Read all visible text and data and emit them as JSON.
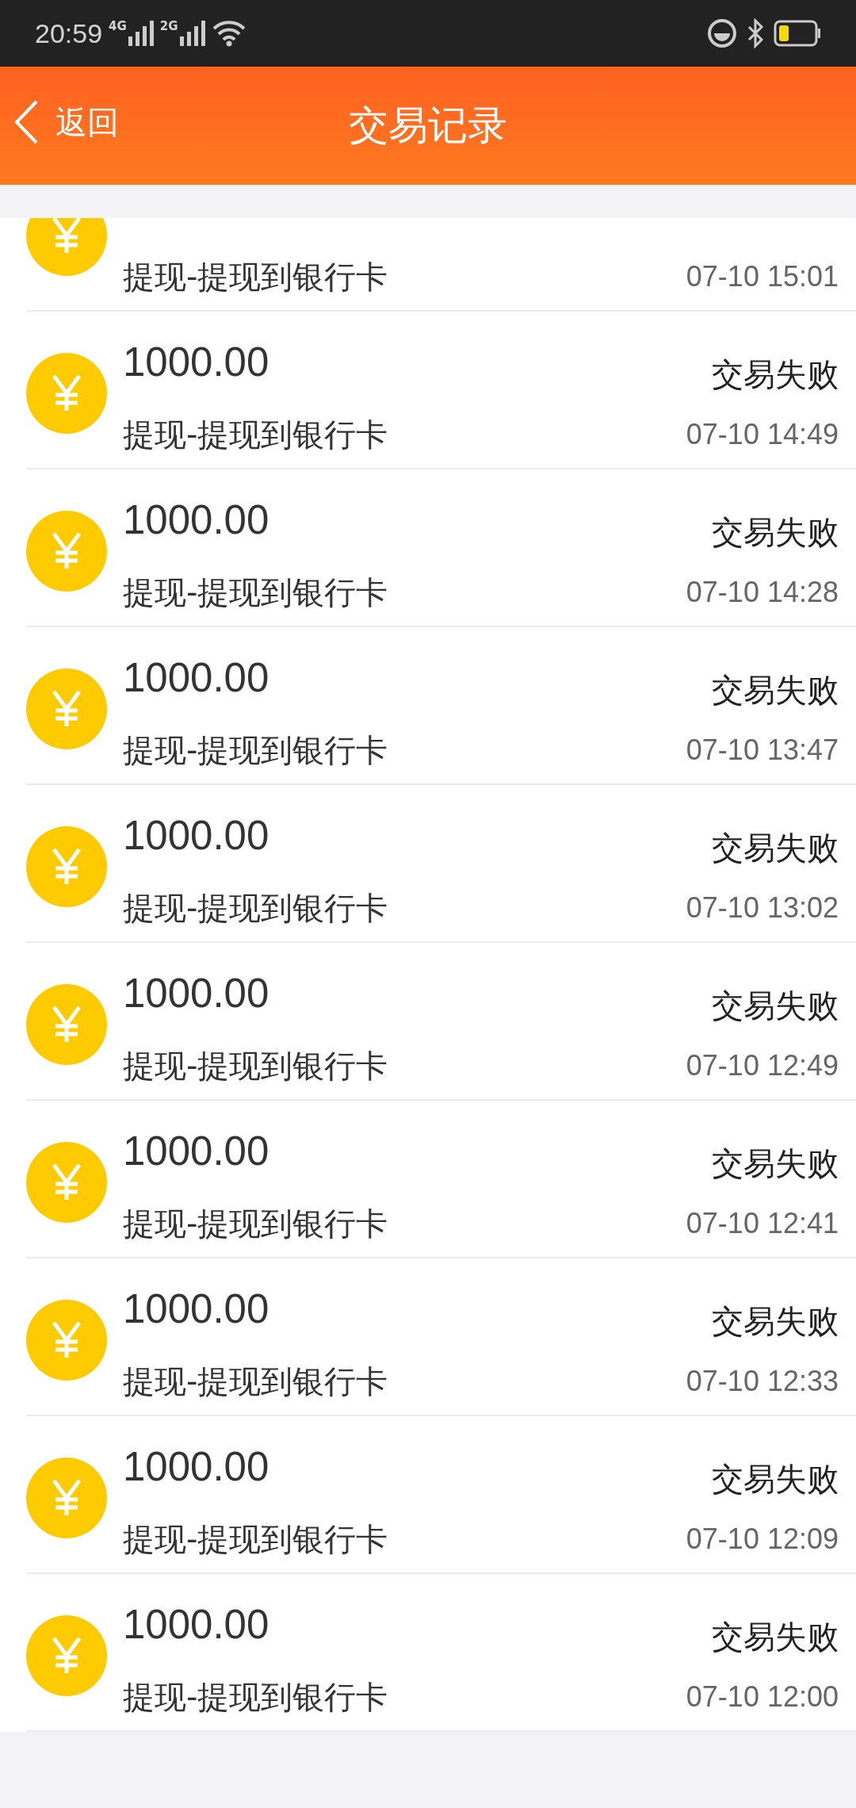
{
  "status_bar": {
    "time": "20:59",
    "networks": [
      "4G",
      "2G"
    ]
  },
  "header": {
    "back_label": "返回",
    "title": "交易记录"
  },
  "records": [
    {
      "subtitle": "提现-提现到银行卡",
      "time": "07-10 15:01"
    },
    {
      "amount": "1000.00",
      "subtitle": "提现-提现到银行卡",
      "status": "交易失败",
      "time": "07-10 14:49"
    },
    {
      "amount": "1000.00",
      "subtitle": "提现-提现到银行卡",
      "status": "交易失败",
      "time": "07-10 14:28"
    },
    {
      "amount": "1000.00",
      "subtitle": "提现-提现到银行卡",
      "status": "交易失败",
      "time": "07-10 13:47"
    },
    {
      "amount": "1000.00",
      "subtitle": "提现-提现到银行卡",
      "status": "交易失败",
      "time": "07-10 13:02"
    },
    {
      "amount": "1000.00",
      "subtitle": "提现-提现到银行卡",
      "status": "交易失败",
      "time": "07-10 12:49"
    },
    {
      "amount": "1000.00",
      "subtitle": "提现-提现到银行卡",
      "status": "交易失败",
      "time": "07-10 12:41"
    },
    {
      "amount": "1000.00",
      "subtitle": "提现-提现到银行卡",
      "status": "交易失败",
      "time": "07-10 12:33"
    },
    {
      "amount": "1000.00",
      "subtitle": "提现-提现到银行卡",
      "status": "交易失败",
      "time": "07-10 12:09"
    },
    {
      "amount": "1000.00",
      "subtitle": "提现-提现到银行卡",
      "status": "交易失败",
      "time": "07-10 12:00"
    }
  ]
}
